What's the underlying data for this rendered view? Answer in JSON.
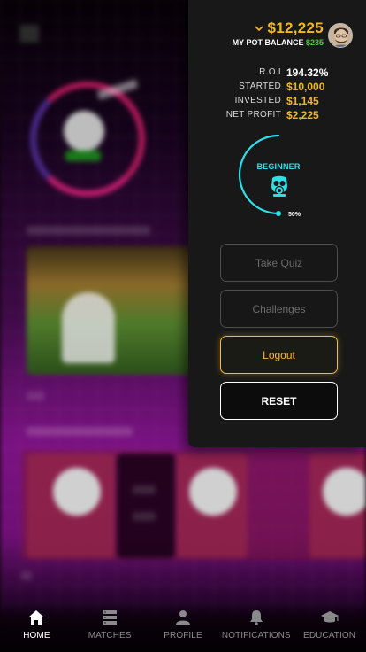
{
  "header": {
    "balance": "$12,225",
    "pot_label": "MY POT BALANCE",
    "pot_value": "$235"
  },
  "stats": [
    {
      "label": "R.O.I",
      "value": "194.32%"
    },
    {
      "label": "STARTED",
      "value": "$10,000"
    },
    {
      "label": "INVESTED",
      "value": "$1,145"
    },
    {
      "label": "NET PROFIT",
      "value": "$2,225"
    }
  ],
  "level": {
    "name": "BEGINNER",
    "progress_label": "50%",
    "progress": 0.5
  },
  "buttons": {
    "quiz": "Take Quiz",
    "challenges": "Challenges",
    "logout": "Logout",
    "reset": "RESET"
  },
  "nav": [
    {
      "label": "HOME",
      "icon": "home-icon",
      "active": true
    },
    {
      "label": "MATCHES",
      "icon": "matches-icon",
      "active": false
    },
    {
      "label": "PROFILE",
      "icon": "profile-icon",
      "active": false
    },
    {
      "label": "NOTIFICATIONS",
      "icon": "bell-icon",
      "active": false
    },
    {
      "label": "EDUCATION",
      "icon": "graduation-cap-icon",
      "active": false
    }
  ],
  "colors": {
    "accent_gold": "#f5b621",
    "pot_green": "#4bd133",
    "level_cyan": "#2ce0ea",
    "panel_bg": "#181818"
  }
}
